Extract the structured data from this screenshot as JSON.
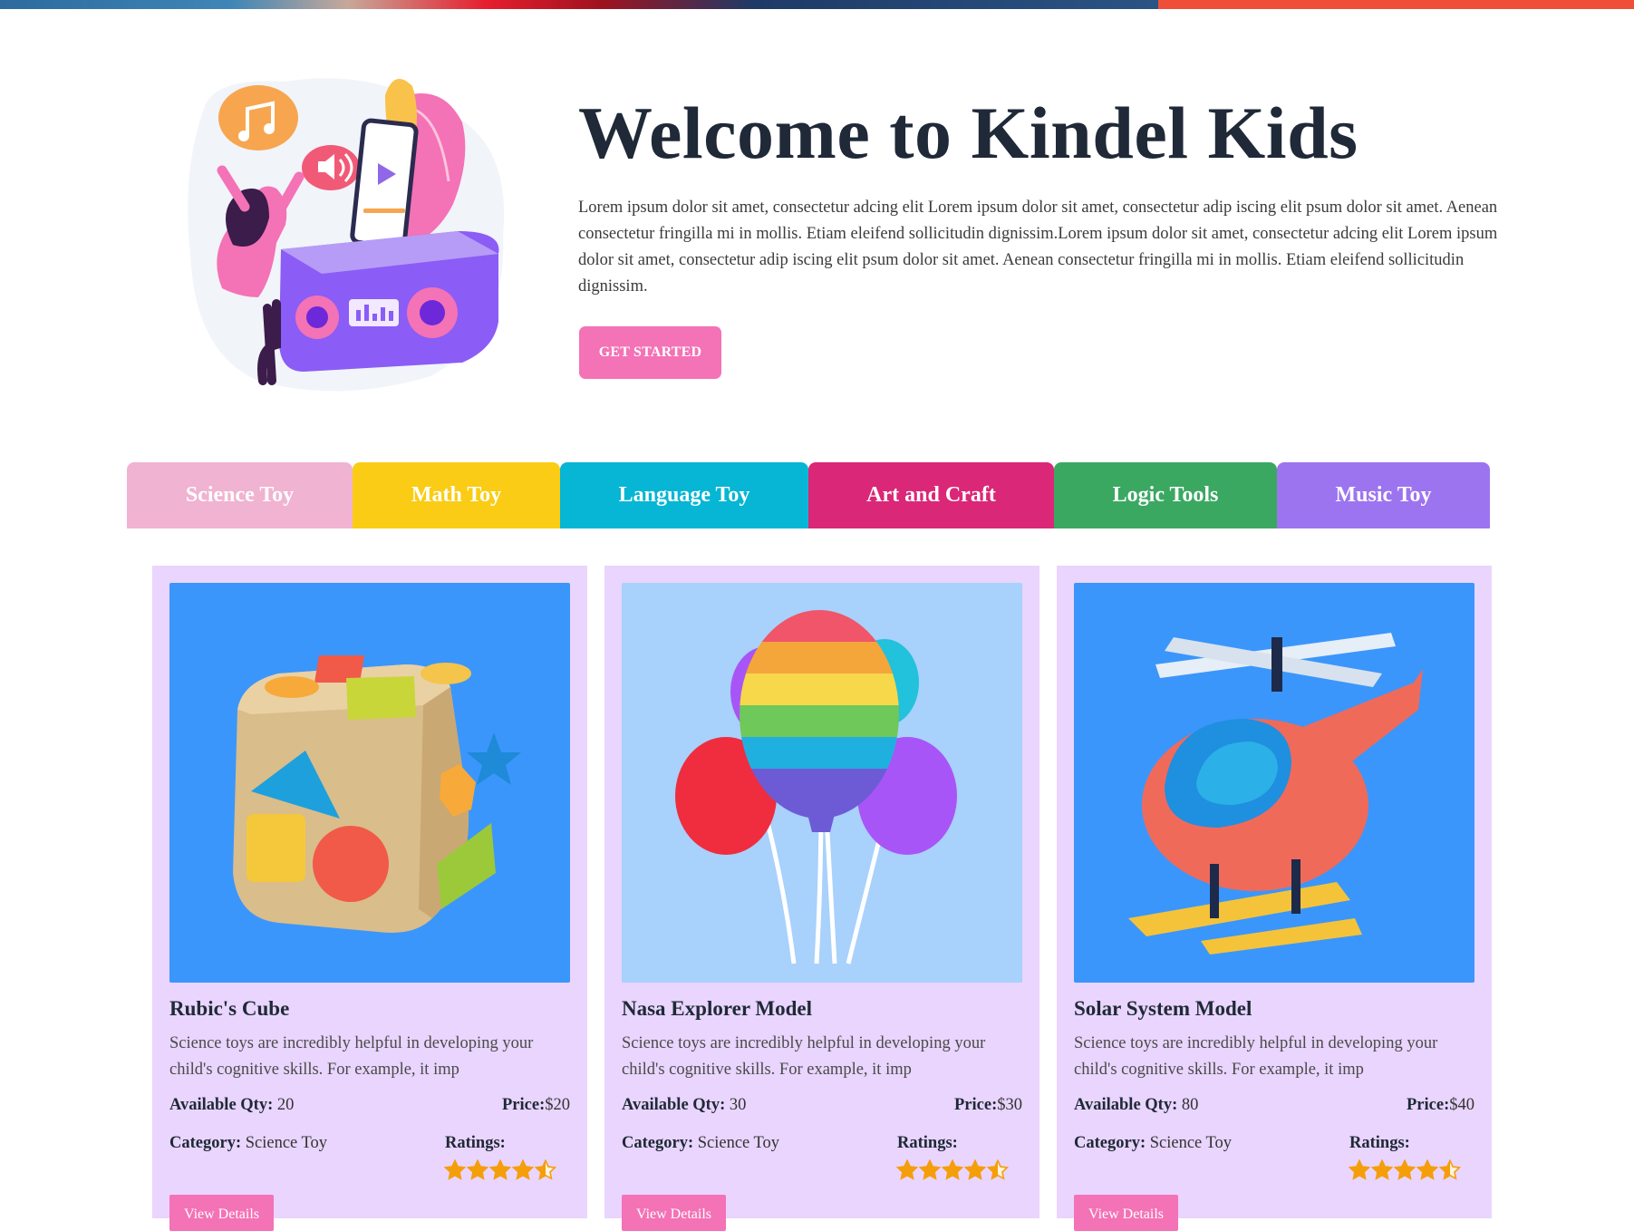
{
  "hero": {
    "title": "Welcome to Kindel Kids",
    "text": "Lorem ipsum dolor sit amet, consectetur adcing elit Lorem ipsum dolor sit amet, consectetur adip iscing elit psum dolor sit amet. Aenean consectetur fringilla mi in mollis. Etiam eleifend sollicitudin dignissim.Lorem ipsum dolor sit amet, consectetur adcing elit Lorem ipsum dolor sit amet, consectetur adip iscing elit psum dolor sit amet. Aenean consectetur fringilla mi in mollis. Etiam eleifend sollicitudin dignissim.",
    "cta_label": "GET STARTED"
  },
  "tabs": [
    {
      "label": "Science Toy",
      "color": "#f0b3d1"
    },
    {
      "label": "Math Toy",
      "color": "#facc15"
    },
    {
      "label": "Language Toy",
      "color": "#06b6d4"
    },
    {
      "label": "Art and Craft",
      "color": "#db2777"
    },
    {
      "label": "Logic Tools",
      "color": "#3ba862"
    },
    {
      "label": "Music Toy",
      "color": "#9d74f0"
    }
  ],
  "cards": [
    {
      "title": "Rubic's Cube",
      "description": "Science toys are incredibly helpful in developing your child's cognitive skills. For example, it imp",
      "qty_label": "Available Qty:",
      "qty": "20",
      "price_label": "Price:",
      "price": "$20",
      "category_label": "Category:",
      "category": "Science Toy",
      "ratings_label": "Ratings:",
      "rating": 4.5,
      "button_label": "View Details",
      "image_bg": "#3b96fb"
    },
    {
      "title": "Nasa Explorer Model",
      "description": "Science toys are incredibly helpful in developing your child's cognitive skills. For example, it imp",
      "qty_label": "Available Qty:",
      "qty": "30",
      "price_label": "Price:",
      "price": "$30",
      "category_label": "Category:",
      "category": "Science Toy",
      "ratings_label": "Ratings:",
      "rating": 4.5,
      "button_label": "View Details",
      "image_bg": "#a8d1fc"
    },
    {
      "title": "Solar System Model",
      "description": "Science toys are incredibly helpful in developing your child's cognitive skills. For example, it imp",
      "qty_label": "Available Qty:",
      "qty": "80",
      "price_label": "Price:",
      "price": "$40",
      "category_label": "Category:",
      "category": "Science Toy",
      "ratings_label": "Ratings:",
      "rating": 4.5,
      "button_label": "View Details",
      "image_bg": "#3b96fb"
    }
  ],
  "colors": {
    "accent_pink": "#f472b6",
    "card_bg": "#e9d5fd",
    "title_dark": "#1f2937",
    "star_orange": "#f59e0b"
  }
}
